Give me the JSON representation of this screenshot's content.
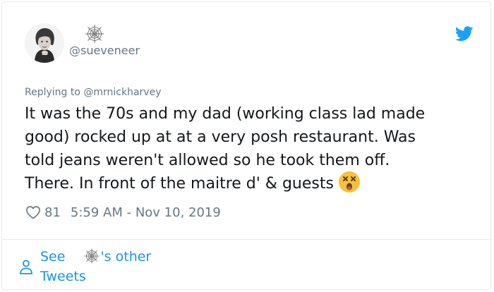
{
  "tweet": {
    "handle": "@sueveneer",
    "replying_to": "Replying to @mrnickharvey",
    "text_lines": [
      "It was the 70s and my dad (working class lad made",
      "good) rocked up at at a very posh restaurant. Was",
      "told jeans weren't allowed so he took them off.",
      "There. In front of the maitre d' & guests"
    ],
    "likes": "81",
    "timestamp": "5:59 AM - Nov 10, 2019"
  },
  "footer": {
    "see_label": "See",
    "others_label": "'s other",
    "tweets_label": "Tweets"
  },
  "icons": {
    "display_name": "spider-web-icon",
    "platform": "twitter-bird-icon",
    "reaction": "astonished-face-emoji",
    "like": "heart-icon",
    "profile": "person-icon"
  },
  "colors": {
    "link_blue": "#1b95e0",
    "twitter_blue": "#1da1f2",
    "muted_gray": "#657786",
    "text_dark": "#14171a",
    "emoji_yellow": "#f7c13a"
  }
}
